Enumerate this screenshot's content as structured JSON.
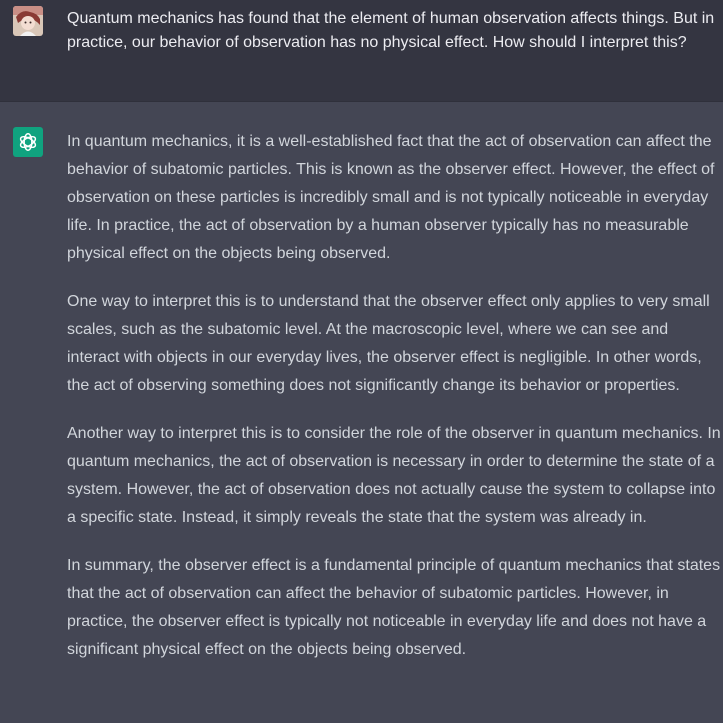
{
  "colors": {
    "user_background": "#343541",
    "assistant_background": "#444654",
    "assistant_avatar": "#10a37f",
    "user_text": "#ececf1",
    "assistant_text": "#d1d5db"
  },
  "user_message": {
    "avatar_icon": "user-avatar-image",
    "text": "Quantum mechanics has found that the element of human observation affects things. But in practice, our behavior of observation has no physical effect. How should I interpret this?"
  },
  "assistant_message": {
    "avatar_icon": "openai-logo-icon",
    "paragraphs": [
      "In quantum mechanics, it is a well-established fact that the act of observation can affect the behavior of subatomic particles. This is known as the observer effect. However, the effect of observation on these particles is incredibly small and is not typically noticeable in everyday life. In practice, the act of observation by a human observer typically has no measurable physical effect on the objects being observed.",
      "One way to interpret this is to understand that the observer effect only applies to very small scales, such as the subatomic level. At the macroscopic level, where we can see and interact with objects in our everyday lives, the observer effect is negligible. In other words, the act of observing something does not significantly change its behavior or properties.",
      "Another way to interpret this is to consider the role of the observer in quantum mechanics. In quantum mechanics, the act of observation is necessary in order to determine the state of a system. However, the act of observation does not actually cause the system to collapse into a specific state. Instead, it simply reveals the state that the system was already in.",
      "In summary, the observer effect is a fundamental principle of quantum mechanics that states that the act of observation can affect the behavior of subatomic particles. However, in practice, the observer effect is typically not noticeable in everyday life and does not have a significant physical effect on the objects being observed."
    ]
  }
}
